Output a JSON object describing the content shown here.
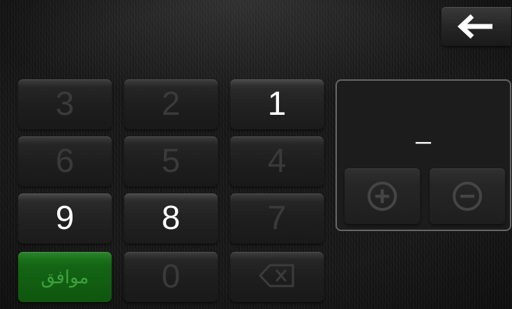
{
  "header": {
    "back_icon": "arrow-left-icon"
  },
  "keypad": {
    "keys": [
      {
        "label": "3",
        "enabled": false
      },
      {
        "label": "2",
        "enabled": false
      },
      {
        "label": "1",
        "enabled": true
      },
      {
        "label": "6",
        "enabled": false
      },
      {
        "label": "5",
        "enabled": false
      },
      {
        "label": "4",
        "enabled": false
      },
      {
        "label": "9",
        "enabled": true
      },
      {
        "label": "8",
        "enabled": true
      },
      {
        "label": "7",
        "enabled": false
      },
      {
        "label": "0",
        "enabled": false
      }
    ],
    "ok_label": "موافق",
    "ok_color": "#146414",
    "backspace_icon": "backspace-icon"
  },
  "display": {
    "value": "_",
    "plus_icon": "plus-circle-icon",
    "minus_icon": "minus-circle-icon"
  }
}
